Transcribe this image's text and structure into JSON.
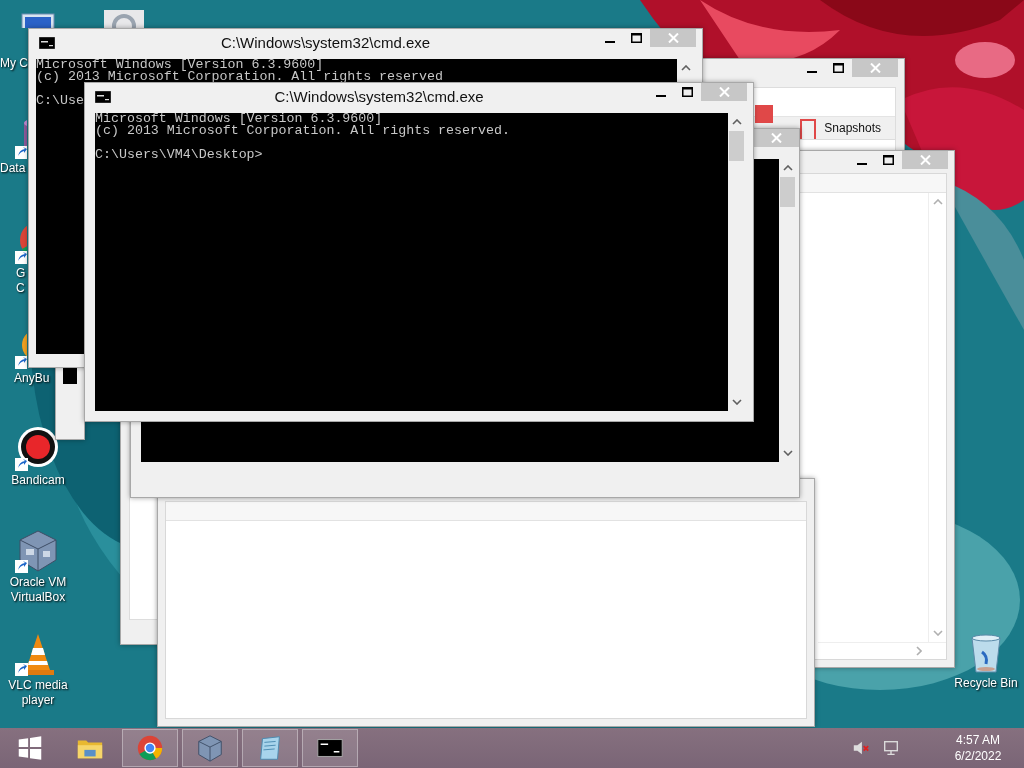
{
  "desktop_icons": [
    {
      "kind": "computer",
      "lines": [
        "My C"
      ]
    },
    {
      "kind": "gear"
    },
    {
      "kind": "database",
      "lines": [
        "Data"
      ]
    },
    {
      "kind": "browser",
      "lines": [
        "G",
        "C"
      ]
    },
    {
      "kind": "burn",
      "lines": [
        "AnyBu"
      ]
    },
    {
      "kind": "record",
      "lines": [
        "Bandicam"
      ]
    },
    {
      "kind": "cube",
      "lines": [
        "Oracle VM",
        "VirtualBox"
      ]
    },
    {
      "kind": "cone",
      "lines": [
        "VLC media",
        "player"
      ]
    },
    {
      "kind": "trash",
      "lines": [
        "Recycle Bin"
      ]
    }
  ],
  "windows": [
    {
      "kind": "manager",
      "tab": "Snapshots"
    },
    {
      "kind": "blank"
    },
    {
      "kind": "blank"
    },
    {
      "kind": "console"
    },
    {
      "kind": "console"
    },
    {
      "kind": "console",
      "title": "C:\\Windows\\system32\\cmd.exe",
      "header": [
        "Microsoft Windows [Version 6.3.9600]",
        "(c) 2013 Microsoft Corporation. All rights reserved"
      ],
      "prompt": "C:\\Use"
    },
    {
      "kind": "console",
      "title": "C:\\Windows\\system32\\cmd.exe",
      "header": [
        "Microsoft Windows [Version 6.3.9600]",
        "(c) 2013 Microsoft Corporation. All rights reserved."
      ],
      "prompt": "C:\\Users\\VM4\\Desktop>"
    }
  ],
  "taskbar": {
    "buttons": [
      {
        "kind": "start",
        "open": false
      },
      {
        "kind": "folder",
        "open": false
      },
      {
        "kind": "browser",
        "open": true
      },
      {
        "kind": "cube",
        "open": true
      },
      {
        "kind": "notepad",
        "open": true
      },
      {
        "kind": "console",
        "open": true
      }
    ],
    "clock": {
      "time": "4:57 AM",
      "date": "6/2/2022"
    }
  }
}
